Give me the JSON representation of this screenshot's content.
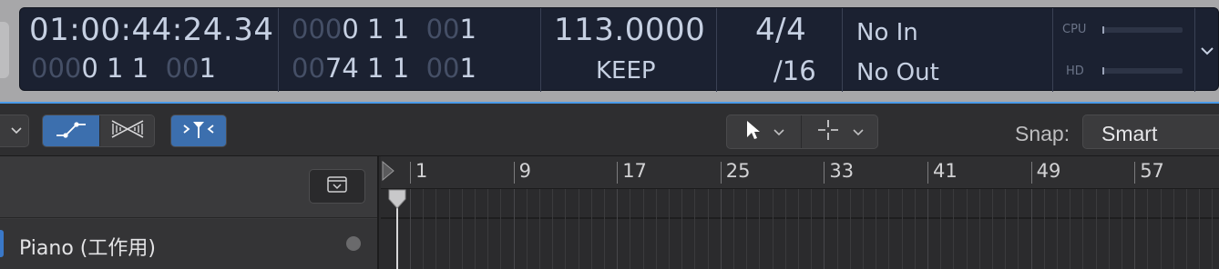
{
  "lcd": {
    "time": {
      "main": "01:00:44:24.34",
      "sub_dim": "000",
      "sub": "0 1 1",
      "sub2_dim": "00",
      "sub2": "1"
    },
    "position": {
      "top_dim": "000",
      "top": "0 1 1",
      "top2_dim": "00",
      "top2": "1",
      "bottom_dim": "00",
      "bottom": "74 1 1",
      "bottom2_dim": "00",
      "bottom2": "1"
    },
    "tempo": {
      "value": "113.0000",
      "mode": "KEEP"
    },
    "signature": {
      "time_sig": "4/4",
      "division": "/16"
    },
    "locators": {
      "in": "No In",
      "out": "No Out"
    },
    "meters": {
      "cpu_label": "CPU",
      "hd_label": "HD"
    }
  },
  "toolbar": {
    "snap_label": "Snap:",
    "snap_value": "Smart"
  },
  "ruler": {
    "bars": [
      "1",
      "9",
      "17",
      "25",
      "33",
      "41",
      "49",
      "57"
    ]
  },
  "tracks": [
    {
      "name": "Piano (工作用)",
      "color": "#3a78c8"
    }
  ],
  "icons": {
    "left_dropdown": "chevron-down-icon",
    "automation": "automation-curve-icon",
    "flex": "flex-icon",
    "catch": "catch-playhead-icon",
    "pointer_tool": "pointer-tool-icon",
    "marquee_tool": "crosshair-tool-icon",
    "collapse": "collapse-icon",
    "lcd_menu": "chevron-down-icon"
  },
  "colors": {
    "accent": "#3c6fae",
    "separator": "#4a9ae8",
    "lcd_bg": "#1b2131"
  }
}
